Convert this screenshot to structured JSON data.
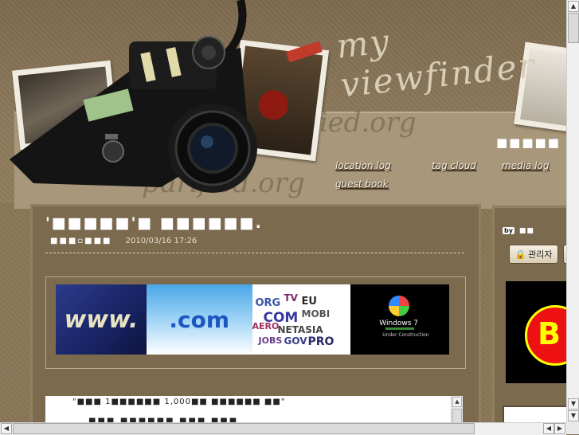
{
  "header": {
    "logo_text": "my viewfinder",
    "top_right_blocks": "■■■■■",
    "nav": {
      "location_log": "location log",
      "tag_cloud": "tag cloud",
      "media_log": "media log",
      "guest_book": "guest book"
    },
    "paper_script_1": "purified.org",
    "paper_script_2": "purified.org"
  },
  "post": {
    "title": "'■■■■■'■ ■■■■■■.",
    "category": "■■■▫■■■",
    "date": "2010/03/16 17:26",
    "banner": {
      "www_text": "www.",
      "com_text": ".com",
      "win_text": "Windows 7",
      "win_sub": "Under Construction"
    },
    "content_line1": "\"■■■ 1■■■■■■ 1,000■■ ■■■■■■ ■■\"",
    "content_line2": "■■■ ■■■■■■ ■■■ ■■■"
  },
  "sidebar": {
    "by_label": "by",
    "by_name": "■■",
    "admin_label": "관리자"
  },
  "colors": {
    "page_bg": "#8c795b",
    "panel_bg": "#7c6a4f",
    "panel_border": "#927f61"
  }
}
